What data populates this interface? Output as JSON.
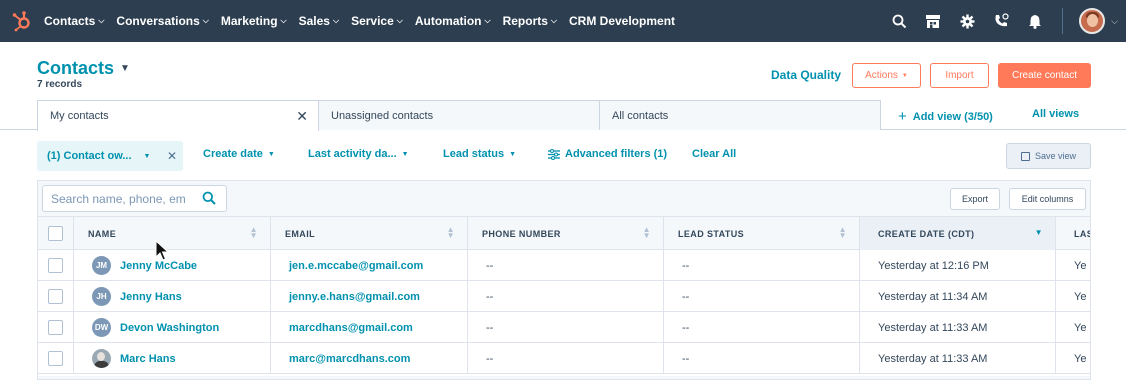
{
  "nav": {
    "items": [
      {
        "label": "Contacts",
        "chevron": true
      },
      {
        "label": "Conversations",
        "chevron": true
      },
      {
        "label": "Marketing",
        "chevron": true
      },
      {
        "label": "Sales",
        "chevron": true
      },
      {
        "label": "Service",
        "chevron": true
      },
      {
        "label": "Automation",
        "chevron": true
      },
      {
        "label": "Reports",
        "chevron": true
      },
      {
        "label": "CRM Development",
        "chevron": false
      }
    ],
    "icons": [
      "search-icon",
      "marketplace-icon",
      "settings-gear-icon",
      "calling-icon",
      "notifications-bell-icon"
    ]
  },
  "header": {
    "title": "Contacts",
    "record_count": "7 records",
    "data_quality": "Data Quality",
    "actions_label": "Actions",
    "import_label": "Import",
    "create_label": "Create contact"
  },
  "views": {
    "tabs": [
      {
        "label": "My contacts",
        "active": true,
        "closable": true
      },
      {
        "label": "Unassigned contacts",
        "active": false,
        "closable": false
      },
      {
        "label": "All contacts",
        "active": false,
        "closable": false
      }
    ],
    "add_view": "Add view (3/50)",
    "all_views": "All views"
  },
  "filters": {
    "owner": "(1) Contact ow...",
    "create_date": "Create date",
    "last_activity": "Last activity da...",
    "lead_status": "Lead status",
    "advanced": "Advanced filters (1)",
    "clear_all": "Clear All",
    "save_view": "Save view"
  },
  "table": {
    "search_placeholder": "Search name, phone, em",
    "export_label": "Export",
    "edit_columns_label": "Edit columns",
    "columns": [
      "NAME",
      "EMAIL",
      "PHONE NUMBER",
      "LEAD STATUS",
      "CREATE DATE (CDT)",
      "LAS"
    ],
    "rows": [
      {
        "initials": "JM",
        "name": "Jenny McCabe",
        "email": "jen.e.mccabe@gmail.com",
        "phone": "--",
        "lead_status": "--",
        "create_date": "Yesterday at 12:16 PM",
        "last": "Ye"
      },
      {
        "initials": "JH",
        "name": "Jenny Hans",
        "email": "jenny.e.hans@gmail.com",
        "phone": "--",
        "lead_status": "--",
        "create_date": "Yesterday at 11:34 AM",
        "last": "Ye"
      },
      {
        "initials": "DW",
        "name": "Devon Washington",
        "email": "marcdhans@gmail.com",
        "phone": "--",
        "lead_status": "--",
        "create_date": "Yesterday at 11:33 AM",
        "last": "Ye"
      },
      {
        "initials": "",
        "name": "Marc Hans",
        "email": "marc@marcdhans.com",
        "phone": "--",
        "lead_status": "--",
        "create_date": "Yesterday at 11:33 AM",
        "last": "Ye"
      }
    ]
  },
  "colors": {
    "nav_bg": "#2d3e50",
    "link": "#0091ae",
    "accent": "#ff7a59",
    "text": "#33475b"
  }
}
